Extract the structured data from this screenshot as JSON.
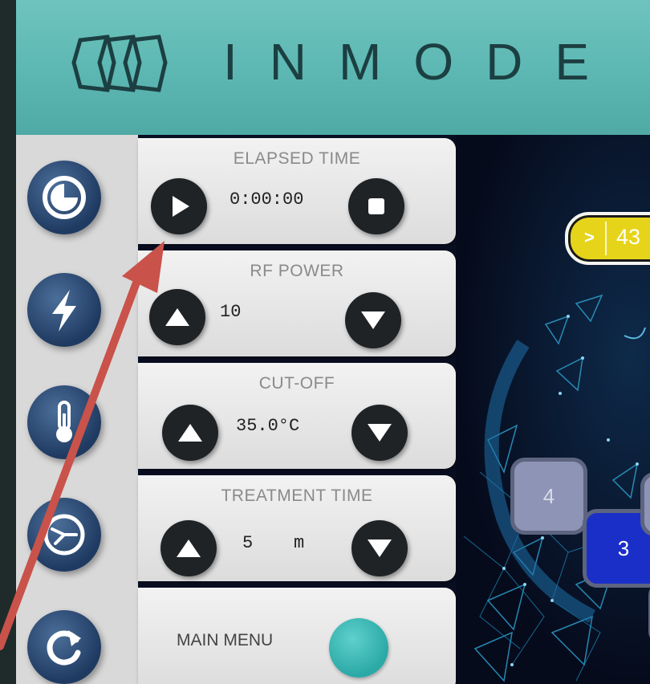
{
  "brand": {
    "name": "INMODE"
  },
  "panels": {
    "elapsed": {
      "title": "ELAPSED TIME",
      "value": "0:00:00"
    },
    "rf_power": {
      "title": "RF POWER",
      "value": "10"
    },
    "cutoff": {
      "title": "CUT-OFF",
      "value": "35.0°C"
    },
    "treatment": {
      "title": "TREATMENT TIME",
      "value": "5",
      "unit": "m"
    },
    "main_menu": {
      "label": "MAIN MENU"
    }
  },
  "indicator": {
    "chevron": ">",
    "value": "43"
  },
  "tiles": [
    {
      "label": "4"
    },
    {
      "label": "3"
    }
  ],
  "icons": {
    "side": [
      "clock-icon",
      "lightning-icon",
      "thermometer-icon",
      "timer-icon",
      "refresh-icon"
    ],
    "elapsed_left": "play-icon",
    "elapsed_right": "stop-icon",
    "up": "arrow-up-icon",
    "down": "arrow-down-icon"
  },
  "colors": {
    "header": "#5cb7b2",
    "brand_text": "#1c3f42",
    "side_icon": "#1f3a61",
    "button": "#1f2326",
    "indicator": "#e6d41a",
    "menu_dot": "#2aa9a6",
    "annotation_arrow": "#c9524a"
  }
}
